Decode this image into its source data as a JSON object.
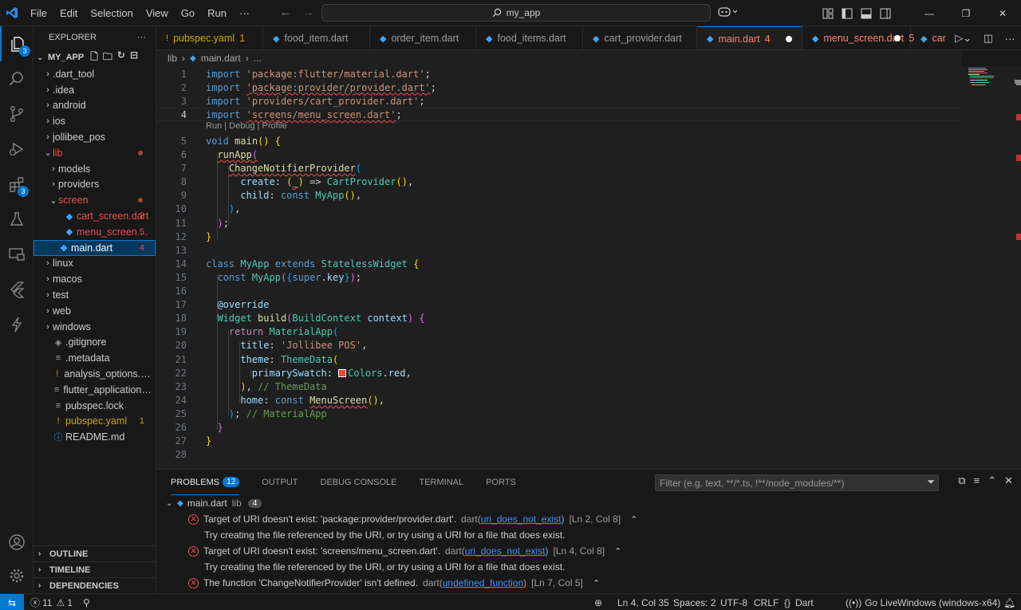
{
  "titlebar": {
    "menu": [
      "File",
      "Edit",
      "Selection",
      "View",
      "Go",
      "Run",
      "···"
    ],
    "search_text": "my_app"
  },
  "activity": {
    "explorer_badge": "3",
    "extensions_badge": "3"
  },
  "explorer": {
    "title": "EXPLORER",
    "more": "···",
    "folder": "MY_APP",
    "tree": [
      {
        "label": ".dart_tool",
        "indent": 0,
        "type": "folder"
      },
      {
        "label": ".idea",
        "indent": 0,
        "type": "folder"
      },
      {
        "label": "android",
        "indent": 0,
        "type": "folder"
      },
      {
        "label": "ios",
        "indent": 0,
        "type": "folder"
      },
      {
        "label": "jollibee_pos",
        "indent": 0,
        "type": "folder"
      },
      {
        "label": "lib",
        "indent": 0,
        "type": "folder-open",
        "status": "dot",
        "color": "red"
      },
      {
        "label": "models",
        "indent": 1,
        "type": "folder"
      },
      {
        "label": "providers",
        "indent": 1,
        "type": "folder"
      },
      {
        "label": "screen",
        "indent": 1,
        "type": "folder-open",
        "status": "dot",
        "color": "red"
      },
      {
        "label": "cart_screen.dart",
        "indent": 2,
        "type": "dart",
        "badge": "2",
        "color": "red"
      },
      {
        "label": "menu_screen....",
        "indent": 2,
        "type": "dart",
        "badge": "5",
        "color": "red"
      },
      {
        "label": "main.dart",
        "indent": 1,
        "type": "dart",
        "badge": "4",
        "color": "red",
        "selected": true
      },
      {
        "label": "linux",
        "indent": 0,
        "type": "folder"
      },
      {
        "label": "macos",
        "indent": 0,
        "type": "folder"
      },
      {
        "label": "test",
        "indent": 0,
        "type": "folder"
      },
      {
        "label": "web",
        "indent": 0,
        "type": "folder"
      },
      {
        "label": "windows",
        "indent": 0,
        "type": "folder"
      },
      {
        "label": ".gitignore",
        "indent": 0,
        "type": "git"
      },
      {
        "label": ".metadata",
        "indent": 0,
        "type": "meta"
      },
      {
        "label": "analysis_options.yaml",
        "indent": 0,
        "type": "yaml"
      },
      {
        "label": "flutter_application_3.i...",
        "indent": 0,
        "type": "meta"
      },
      {
        "label": "pubspec.lock",
        "indent": 0,
        "type": "meta"
      },
      {
        "label": "pubspec.yaml",
        "indent": 0,
        "type": "yaml",
        "badge": "1",
        "color": "yellow"
      },
      {
        "label": "README.md",
        "indent": 0,
        "type": "info"
      }
    ],
    "sections": [
      "OUTLINE",
      "TIMELINE",
      "DEPENDENCIES"
    ]
  },
  "tabs": [
    {
      "label": "pubspec.yaml",
      "num": "1",
      "icon": "!",
      "color": "yellow"
    },
    {
      "label": "food_item.dart",
      "icon": "dart"
    },
    {
      "label": "order_item.dart",
      "icon": "dart"
    },
    {
      "label": "food_items.dart",
      "icon": "dart"
    },
    {
      "label": "cart_provider.dart",
      "icon": "dart"
    },
    {
      "label": "main.dart",
      "num": "4",
      "icon": "dart",
      "color": "red",
      "active": true,
      "dirty": true
    },
    {
      "label": "menu_screen.dart",
      "num": "5",
      "icon": "dart",
      "color": "red",
      "dirty": true
    },
    {
      "label": "car",
      "icon": "dart",
      "color": "red"
    }
  ],
  "breadcrumb": [
    "lib",
    "main.dart",
    "..."
  ],
  "editor": {
    "codelens": "Run | Debug | Profile",
    "current_line": 4
  },
  "panel": {
    "tabs": [
      "PROBLEMS",
      "OUTPUT",
      "DEBUG CONSOLE",
      "TERMINAL",
      "PORTS"
    ],
    "problems_count": "12",
    "filter_placeholder": "Filter (e.g. text, **/*.ts, !**/node_modules/**)",
    "group_file": "main.dart",
    "group_dir": "lib",
    "group_count": "4",
    "problems": [
      {
        "message": "Target of URI doesn't exist: 'package:provider/provider.dart'.",
        "source": "dart",
        "code": "uri_does_not_exist",
        "location": "[Ln 2, Col 8]",
        "hint": "Try creating the file referenced by the URI, or try using a URI for a file that does exist."
      },
      {
        "message": "Target of URI doesn't exist: 'screens/menu_screen.dart'.",
        "source": "dart",
        "code": "uri_does_not_exist",
        "location": "[Ln 4, Col 8]",
        "hint": "Try creating the file referenced by the URI, or try using a URI for a file that does exist."
      },
      {
        "message": "The function 'ChangeNotifierProvider' isn't defined.",
        "source": "dart",
        "code": "undefined_function",
        "location": "[Ln 7, Col 5]",
        "hint": ""
      }
    ]
  },
  "status": {
    "errors": "11",
    "warnings": "1",
    "cursor": "Ln 4, Col 35",
    "spaces": "Spaces: 2",
    "encoding": "UTF-8",
    "eol": "CRLF",
    "language": "Dart",
    "golive": "Go Live",
    "device": "Windows (windows-x64)"
  },
  "colors": {
    "accent": "#0078d4",
    "error": "#f14c4c",
    "warning": "#cca700"
  }
}
